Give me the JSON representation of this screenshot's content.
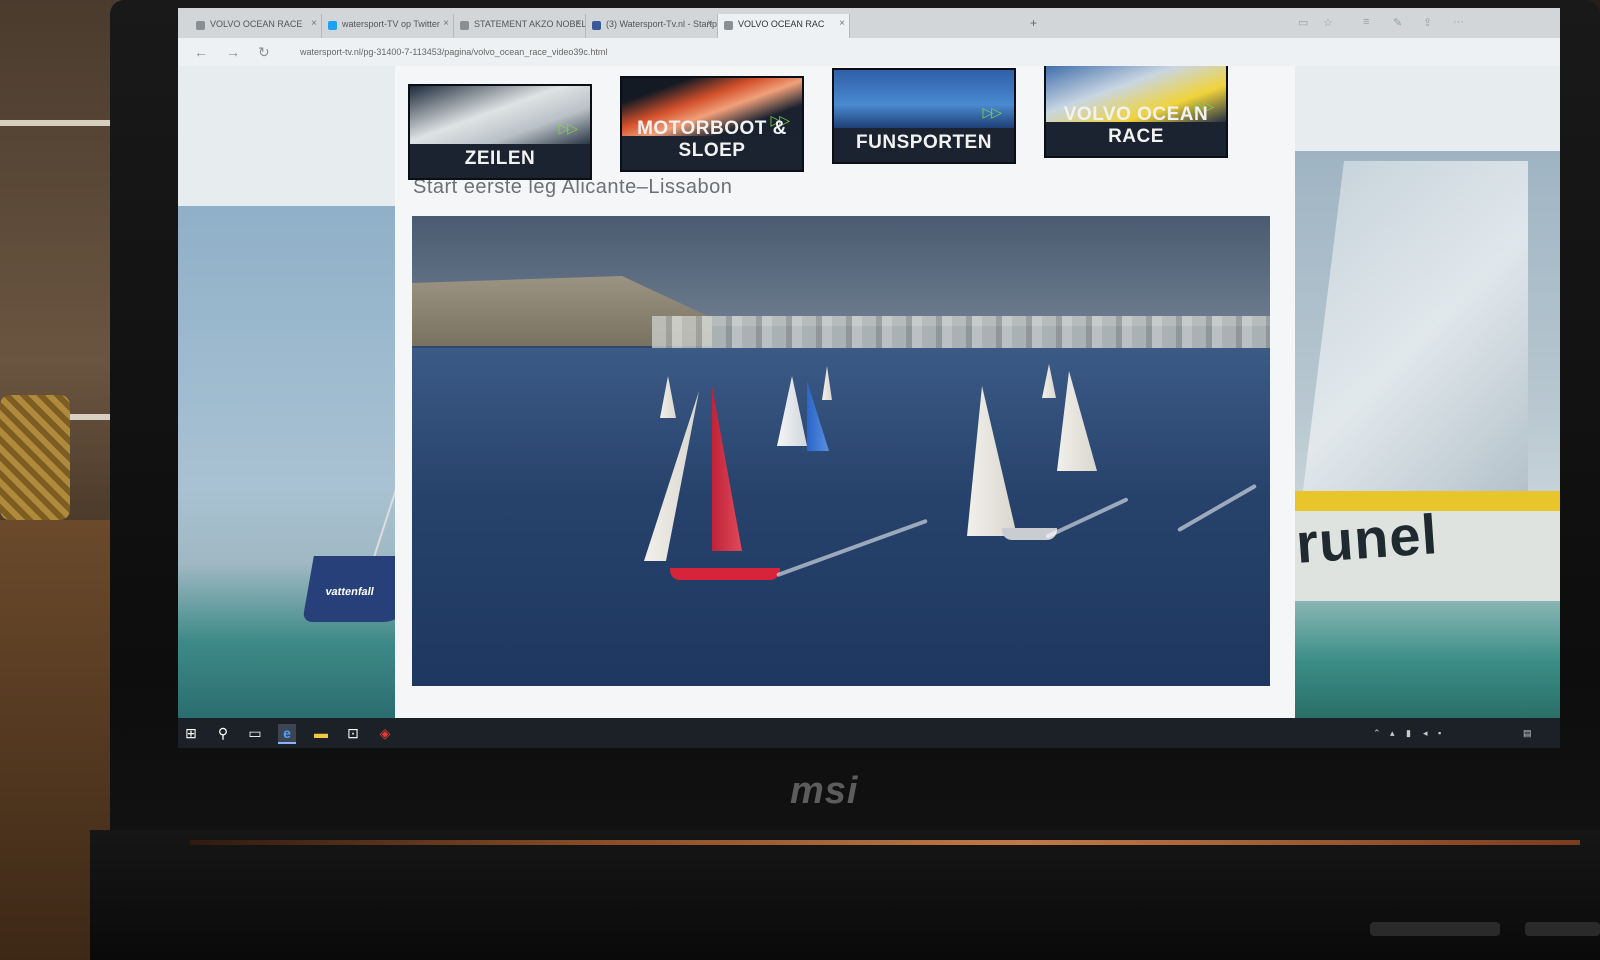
{
  "laptop": {
    "brand": "msi"
  },
  "browser": {
    "tabs": [
      {
        "label": "VOLVO OCEAN RACE",
        "active": false
      },
      {
        "label": "watersport-TV op Twitter",
        "active": false
      },
      {
        "label": "STATEMENT AKZO NOBEL",
        "active": false
      },
      {
        "label": "(3) Watersport-Tv.nl - Startp",
        "active": false
      },
      {
        "label": "VOLVO OCEAN RAC",
        "active": true
      }
    ],
    "url": "watersport-tv.nl/pg-31400-7-113453/pagina/volvo_ocean_race_video39c.html"
  },
  "page": {
    "heading": "Start eerste leg Alicante–Lissabon",
    "categories": [
      {
        "label": "ZEILEN"
      },
      {
        "label": "MOTORBOOT & SLOEP"
      },
      {
        "label": "FUNSPORTEN"
      },
      {
        "label": "VOLVO OCEAN RACE"
      }
    ],
    "background_right_text": "runel",
    "background_left_text": "vattenfall"
  },
  "colors": {
    "nav_tile": "#1b2330",
    "play_arrow": "#7fd34a",
    "brunel_yellow": "#e9c52c"
  },
  "icons": {
    "taskbar": [
      "windows-icon",
      "search-icon",
      "task-view-icon",
      "edge-icon",
      "file-explorer-icon",
      "store-icon",
      "mcafee-icon"
    ]
  }
}
